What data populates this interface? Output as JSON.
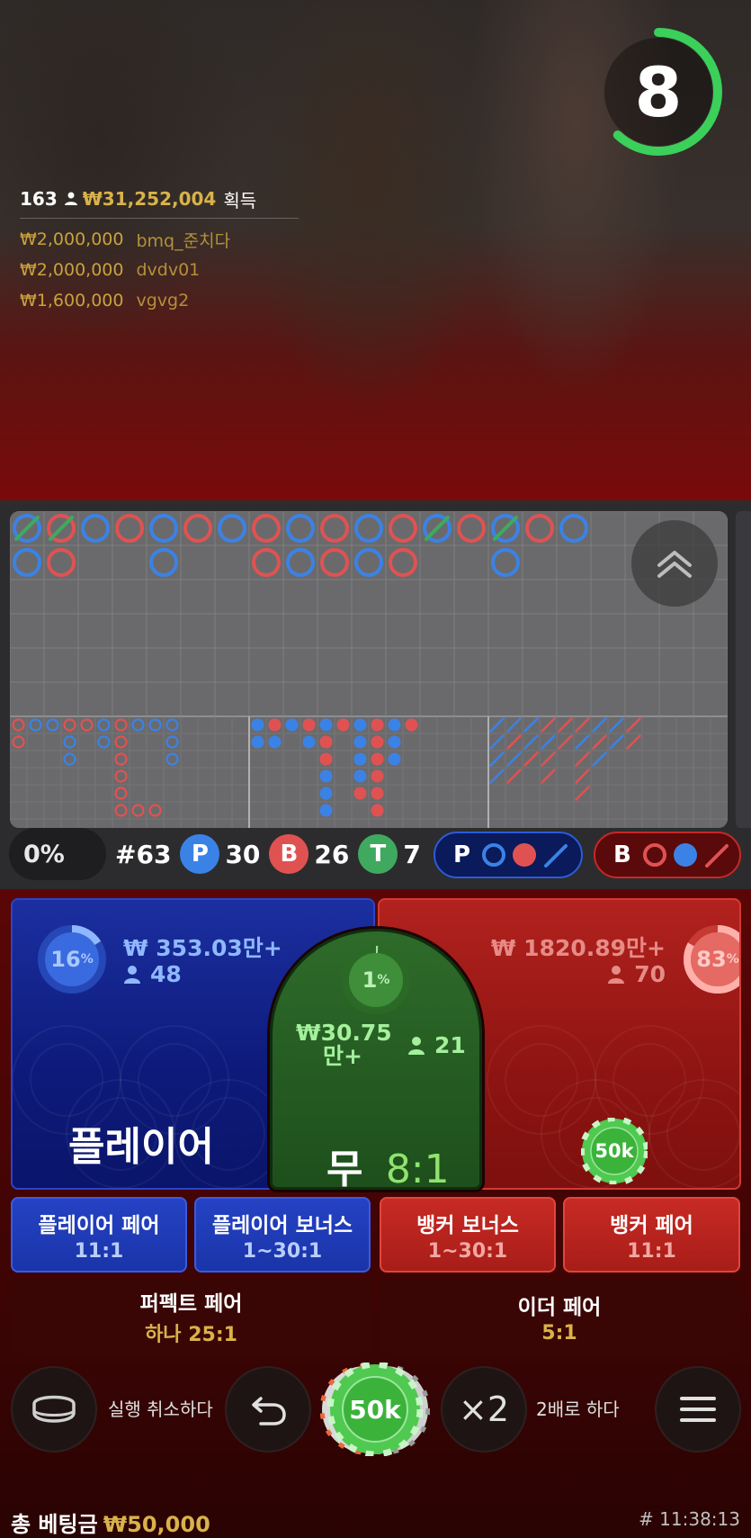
{
  "timer": {
    "value": "8",
    "progress": 0.62,
    "color": "#3ad05a"
  },
  "winners": {
    "count": "163",
    "total": "₩31,252,004",
    "label": "획득",
    "rows": [
      {
        "amount": "₩2,000,000",
        "name": "bmq_준치다"
      },
      {
        "amount": "₩2,000,000",
        "name": "dvdv01"
      },
      {
        "amount": "₩1,600,000",
        "name": "vgvg2"
      }
    ]
  },
  "roadmap": {
    "bead_top": [
      "PT",
      "BT",
      "P",
      "B",
      "P",
      "B",
      "P",
      "B",
      "P",
      "B",
      "P",
      "B",
      "PT",
      "B",
      "PT",
      "B",
      "P"
    ],
    "bead_second": [
      "P",
      "B",
      "",
      "",
      "P",
      "",
      "",
      "B",
      "P",
      "B",
      "P",
      "B",
      "",
      "",
      "P",
      "",
      ""
    ]
  },
  "stats": {
    "percent": "0%",
    "round": "#63",
    "player_letter": "P",
    "player_count": "30",
    "banker_letter": "B",
    "banker_count": "26",
    "tie_letter": "T",
    "tie_count": "7",
    "predict_player": "P",
    "predict_banker": "B"
  },
  "player": {
    "percent": "16",
    "percent_unit": "%",
    "amount": "₩ 353.03만+",
    "count": "48",
    "title": "플레이어",
    "progress": 0.16
  },
  "banker": {
    "percent": "83",
    "percent_unit": "%",
    "amount": "₩ 1820.89만+",
    "count": "70",
    "progress": 0.83,
    "chip": "50k"
  },
  "tie": {
    "percent": "1",
    "percent_unit": "%",
    "amount_line1": "₩30.75",
    "amount_line2": "만+",
    "count": "21",
    "title": "무",
    "odds": "8:1",
    "progress": 0.01
  },
  "side_bets": [
    {
      "title": "플레이어 페어",
      "odds": "11:1"
    },
    {
      "title": "플레이어 보너스",
      "odds": "1~30:1"
    },
    {
      "title": "뱅커 보너스",
      "odds": "1~30:1"
    },
    {
      "title": "뱅커 페어",
      "odds": "11:1"
    }
  ],
  "pair_bets": [
    {
      "title": "퍼펙트 페어",
      "odds": "하나 25:1"
    },
    {
      "title": "이더 페어",
      "odds": "5:1"
    }
  ],
  "controls": {
    "undo_label": "실행 취소하다",
    "chip_value": "50k",
    "double_label": "2배로 하다",
    "double_symbol": "×2"
  },
  "footer": {
    "total_label": "총 베팅금",
    "total_value": "₩50,000",
    "time": "# 11:38:13"
  },
  "colors": {
    "player": "#3b82e6",
    "banker": "#e05252",
    "tie": "#3faa5f",
    "gold": "#d9b24a"
  }
}
